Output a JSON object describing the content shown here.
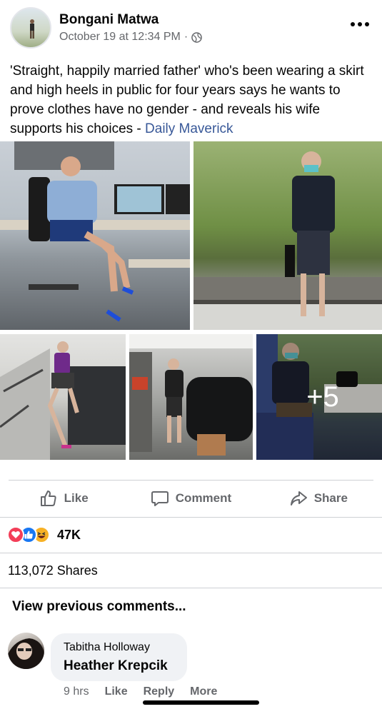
{
  "post": {
    "author": "Bongani Matwa",
    "timestamp": "October 19 at 12:34 PM",
    "separator": "·",
    "privacy_icon": "globe-icon",
    "text": "'Straight, happily married father' who's been wearing a skirt and high heels in public for four years says he wants to prove clothes have no gender - and reveals his wife supports his choices - ",
    "link_text": "Daily Maverick",
    "more_photos": "+5"
  },
  "actions": {
    "like": "Like",
    "comment": "Comment",
    "share": "Share"
  },
  "stats": {
    "reaction_icons": [
      "love-reaction",
      "like-reaction",
      "haha-reaction"
    ],
    "reaction_count": "47K",
    "shares": "113,072 Shares"
  },
  "comments": {
    "view_previous": "View previous comments...",
    "items": [
      {
        "author": "Tabitha Holloway",
        "text": "Heather Krepcik",
        "time": "9 hrs",
        "like": "Like",
        "reply": "Reply",
        "more": "More"
      }
    ]
  },
  "colors": {
    "link": "#385898",
    "secondary_text": "#65676b",
    "bubble": "#f0f2f5",
    "like_blue": "#1877f2",
    "love_red": "#f33e58",
    "haha_yellow": "#f7b125"
  }
}
